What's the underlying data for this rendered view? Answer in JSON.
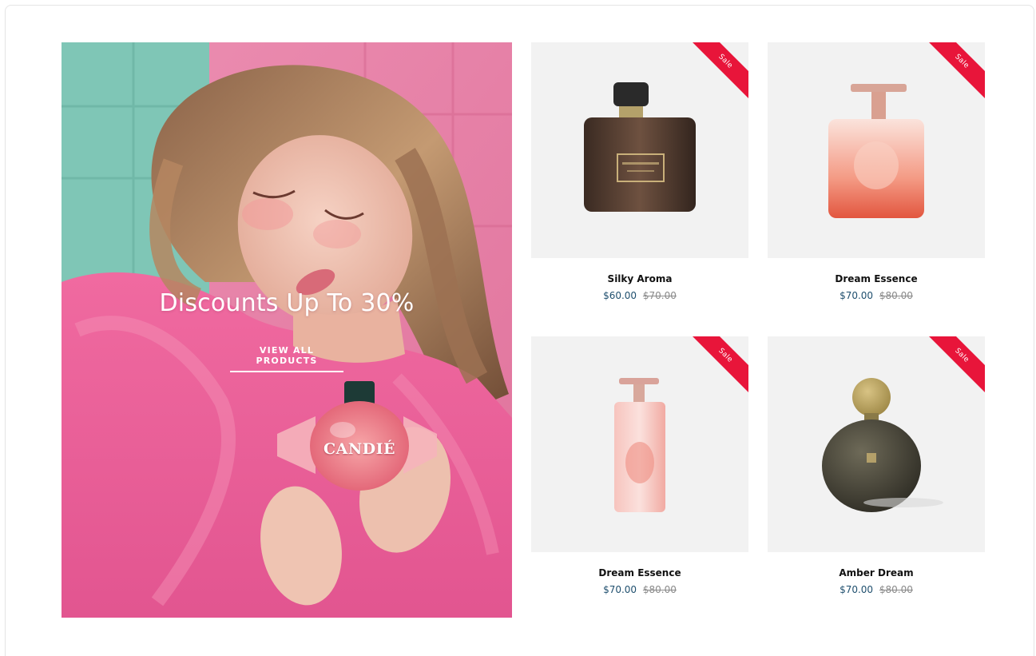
{
  "hero": {
    "title": "Discounts Up To 30%",
    "cta_label": "VIEW ALL PRODUCTS",
    "product_label": "CANDIÉ"
  },
  "products": [
    {
      "name": "Silky Aroma",
      "price": "$60.00",
      "old_price": "$70.00",
      "badge": "Sale",
      "icon": "brown-square-bottle"
    },
    {
      "name": "Dream Essence",
      "price": "$70.00",
      "old_price": "$80.00",
      "badge": "Sale",
      "icon": "coral-square-bottle"
    },
    {
      "name": "Dream Essence",
      "price": "$70.00",
      "old_price": "$80.00",
      "badge": "Sale",
      "icon": "tall-pink-bottle"
    },
    {
      "name": "Amber Dream",
      "price": "$70.00",
      "old_price": "$80.00",
      "badge": "Sale",
      "icon": "round-olive-bottle"
    }
  ],
  "colors": {
    "sale_ribbon": "#e8153a",
    "price": "#1f4f6e",
    "hero_pink": "#e87aa2",
    "card_bg": "#f2f2f2"
  }
}
